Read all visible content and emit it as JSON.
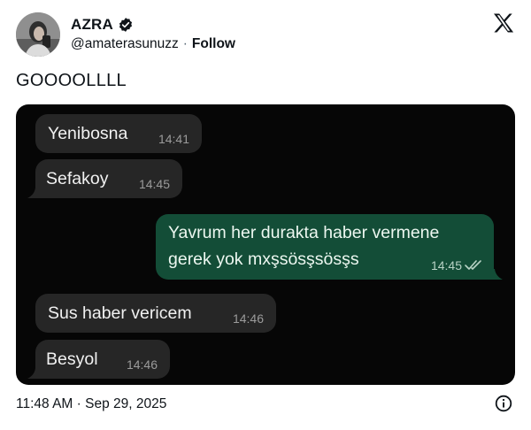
{
  "author": {
    "name": "AZRA",
    "handle": "@amaterasunuzz",
    "separator": "·",
    "follow_label": "Follow"
  },
  "tweet": {
    "text": "GOOOOLLLL"
  },
  "chat": {
    "messages": [
      {
        "direction": "in",
        "text": "Yenibosna",
        "time": "14:41"
      },
      {
        "direction": "in",
        "text": "Sefakoy",
        "time": "14:45"
      },
      {
        "direction": "out",
        "lines": [
          "Yavrum her durakta haber vermene",
          "gerek yok mxşsösşsösşs"
        ],
        "time": "14:45",
        "status": "read"
      },
      {
        "direction": "in",
        "text": "Sus haber vericem",
        "time": "14:46"
      },
      {
        "direction": "in",
        "text": "Besyol",
        "time": "14:46"
      }
    ]
  },
  "footer": {
    "timestamp": "11:48 AM · Sep 29, 2025"
  },
  "icons": {
    "verified": "verified-badge-icon",
    "x_logo": "x-logo-icon",
    "info": "info-icon",
    "read": "double-check-icon"
  },
  "colors": {
    "incoming_bubble": "#262626",
    "outgoing_bubble": "#134d37",
    "chat_background": "#060606"
  }
}
